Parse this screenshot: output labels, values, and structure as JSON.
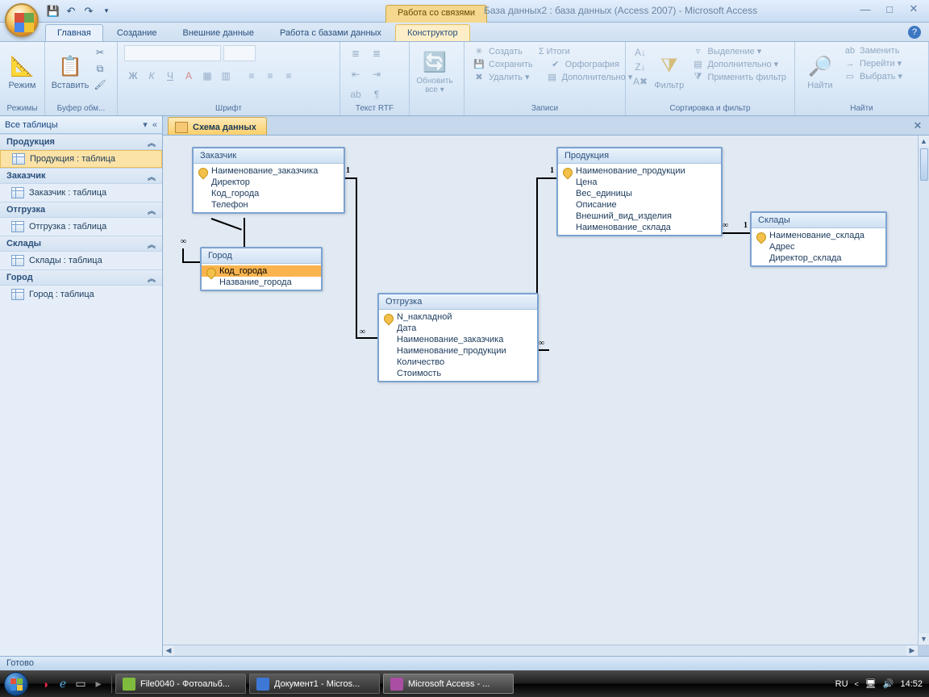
{
  "title_context": "Работа со связями",
  "title_app": "База данных2 : база данных (Access 2007) - Microsoft Access",
  "ribbon_tabs": [
    "Главная",
    "Создание",
    "Внешние данные",
    "Работа с базами данных",
    "Конструктор"
  ],
  "active_tab": 0,
  "ribbon": {
    "g_modes": {
      "title": "Режимы",
      "btn": "Режим"
    },
    "g_clip": {
      "title": "Буфер обм...",
      "btn": "Вставить"
    },
    "g_font": {
      "title": "Шрифт"
    },
    "g_rtf": {
      "title": "Текст RTF"
    },
    "g_records": {
      "title": "Записи",
      "refresh": "Обновить все ▾",
      "create": "Создать",
      "save": "Сохранить",
      "delete": "Удалить ▾",
      "totals": "Σ Итоги",
      "spell": "Орфография",
      "more": "Дополнительно ▾"
    },
    "g_sort": {
      "title": "Сортировка и фильтр",
      "filter": "Фильтр",
      "selection": "Выделение ▾",
      "advanced": "Дополнительно ▾",
      "toggle": "Применить фильтр"
    },
    "g_find": {
      "title": "Найти",
      "find": "Найти",
      "replace": "Заменить",
      "goto": "Перейти ▾",
      "select": "Выбрать ▾"
    }
  },
  "nav": {
    "header": "Все таблицы",
    "groups": [
      {
        "name": "Продукция",
        "items": [
          "Продукция : таблица"
        ],
        "selected": 0
      },
      {
        "name": "Заказчик",
        "items": [
          "Заказчик : таблица"
        ]
      },
      {
        "name": "Отгрузка",
        "items": [
          "Отгрузка : таблица"
        ]
      },
      {
        "name": "Склады",
        "items": [
          "Склады : таблица"
        ]
      },
      {
        "name": "Город",
        "items": [
          "Город : таблица"
        ]
      }
    ]
  },
  "doc_tab": "Схема данных",
  "tables": {
    "zakazchik": {
      "title": "Заказчик",
      "fields": [
        {
          "n": "Наименование_заказчика",
          "k": true
        },
        {
          "n": "Директор"
        },
        {
          "n": "Код_города"
        },
        {
          "n": "Телефон"
        }
      ]
    },
    "gorod": {
      "title": "Город",
      "fields": [
        {
          "n": "Код_города",
          "k": true,
          "sel": true
        },
        {
          "n": "Название_города"
        }
      ]
    },
    "otgruzka": {
      "title": "Отгрузка",
      "fields": [
        {
          "n": "N_накладной",
          "k": true
        },
        {
          "n": "Дата"
        },
        {
          "n": "Наименование_заказчика"
        },
        {
          "n": "Наименование_продукции"
        },
        {
          "n": "Количество"
        },
        {
          "n": "Стоимость"
        }
      ]
    },
    "produkciya": {
      "title": "Продукция",
      "fields": [
        {
          "n": "Наименование_продукции",
          "k": true
        },
        {
          "n": "Цена"
        },
        {
          "n": "Вес_единицы"
        },
        {
          "n": "Описание"
        },
        {
          "n": "Внешний_вид_изделия"
        },
        {
          "n": "Наименование_склада"
        }
      ]
    },
    "sklady": {
      "title": "Склады",
      "fields": [
        {
          "n": "Наименование_склада",
          "k": true
        },
        {
          "n": "Адрес"
        },
        {
          "n": "Директор_склада"
        }
      ]
    }
  },
  "status": "Готово",
  "taskbar": {
    "items": [
      {
        "label": "File0040 - Фотоальб...",
        "color": "#7fbb3d"
      },
      {
        "label": "Документ1 - Micros...",
        "color": "#3d78d6"
      },
      {
        "label": "Microsoft Access - ...",
        "color": "#a94ea2",
        "active": true
      }
    ],
    "lang": "RU",
    "time": "14:52"
  }
}
